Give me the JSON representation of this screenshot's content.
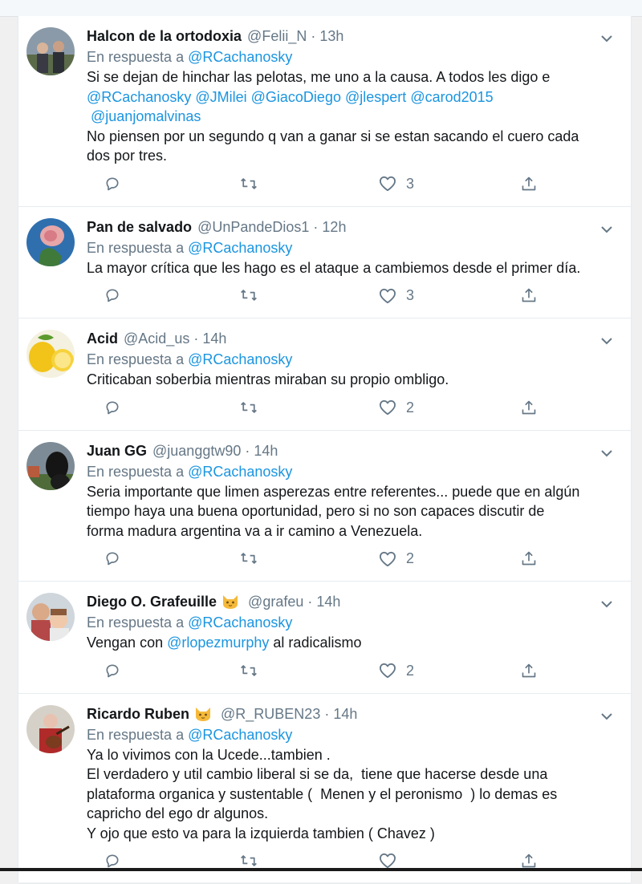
{
  "reply_prefix": "En respuesta a",
  "reply_target": "@RCachanosky",
  "tweets": [
    {
      "name": "Halcon de la ortodoxia",
      "handle": "@Felii_N",
      "sep": "·",
      "time": "13h",
      "badge": false,
      "avatar": "couple-photo",
      "lines": [
        [
          {
            "t": "text",
            "v": "Si se dejan de hinchar las pelotas, me uno a la causa. A todos les digo e"
          }
        ],
        [
          {
            "t": "mention",
            "v": "@RCachanosky"
          },
          {
            "t": "text",
            "v": " "
          },
          {
            "t": "mention",
            "v": "@JMilei"
          },
          {
            "t": "text",
            "v": " "
          },
          {
            "t": "mention",
            "v": "@GiacoDiego"
          },
          {
            "t": "text",
            "v": " "
          },
          {
            "t": "mention",
            "v": "@jlespert"
          },
          {
            "t": "text",
            "v": " "
          },
          {
            "t": "mention",
            "v": "@carod2015"
          }
        ],
        [
          {
            "t": "text",
            "v": " "
          },
          {
            "t": "mention",
            "v": "@juanjomalvinas"
          }
        ],
        [
          {
            "t": "text",
            "v": "No piensen por un segundo q van a ganar si se estan sacando el cuero cada"
          }
        ],
        [
          {
            "t": "text",
            "v": "dos por tres."
          }
        ]
      ],
      "likes": "3"
    },
    {
      "name": "Pan de salvado",
      "handle": "@UnPandeDios1",
      "sep": "·",
      "time": "12h",
      "badge": false,
      "avatar": "rose-photo",
      "lines": [
        [
          {
            "t": "text",
            "v": "La mayor crítica que les hago es el ataque a cambiemos desde el primer día."
          }
        ]
      ],
      "likes": "3"
    },
    {
      "name": "Acid",
      "handle": "@Acid_us",
      "sep": "·",
      "time": "14h",
      "badge": false,
      "avatar": "lemon-photo",
      "lines": [
        [
          {
            "t": "text",
            "v": "Criticaban soberbia mientras miraban su propio ombligo."
          }
        ]
      ],
      "likes": "2"
    },
    {
      "name": "Juan GG",
      "handle": "@juanggtw90",
      "sep": "·",
      "time": "14h",
      "badge": false,
      "avatar": "dog-photo",
      "lines": [
        [
          {
            "t": "text",
            "v": "Seria importante que limen asperezas entre referentes... puede que en algún"
          }
        ],
        [
          {
            "t": "text",
            "v": "tiempo haya una buena oportunidad, pero si no son capaces discutir de"
          }
        ],
        [
          {
            "t": "text",
            "v": "forma madura argentina va a ir camino a Venezuela."
          }
        ]
      ],
      "likes": "2"
    },
    {
      "name": "Diego O. Grafeuille",
      "handle": "@grafeu",
      "sep": "·",
      "time": "14h",
      "badge": true,
      "avatar": "family-photo",
      "lines": [
        [
          {
            "t": "text",
            "v": "Vengan con "
          },
          {
            "t": "mention",
            "v": "@rlopezmurphy"
          },
          {
            "t": "text",
            "v": " al radicalismo"
          }
        ]
      ],
      "likes": "2"
    },
    {
      "name": "Ricardo Ruben",
      "handle": "@R_RUBEN23",
      "sep": "·",
      "time": "14h",
      "badge": true,
      "avatar": "guitar-photo",
      "lines": [
        [
          {
            "t": "text",
            "v": "Ya lo vivimos con la Ucede...tambien ."
          }
        ],
        [
          {
            "t": "text",
            "v": "El verdadero y util cambio liberal si se da,  tiene que hacerse desde una"
          }
        ],
        [
          {
            "t": "text",
            "v": "plataforma organica y sustentable (  Menen y el peronismo  ) lo demas es"
          }
        ],
        [
          {
            "t": "text",
            "v": "capricho del ego dr algunos."
          }
        ],
        [
          {
            "t": "text",
            "v": "Y ojo que esto va para la izquierda tambien ( Chavez )"
          }
        ]
      ],
      "likes": ""
    }
  ],
  "colors": {
    "link": "#1b95e0",
    "muted": "#657786",
    "text": "#14171a",
    "border": "#e6ecf0"
  },
  "icons": [
    "reply-icon",
    "retweet-icon",
    "like-icon",
    "share-icon",
    "chevron-down-icon",
    "cat-badge-icon"
  ]
}
